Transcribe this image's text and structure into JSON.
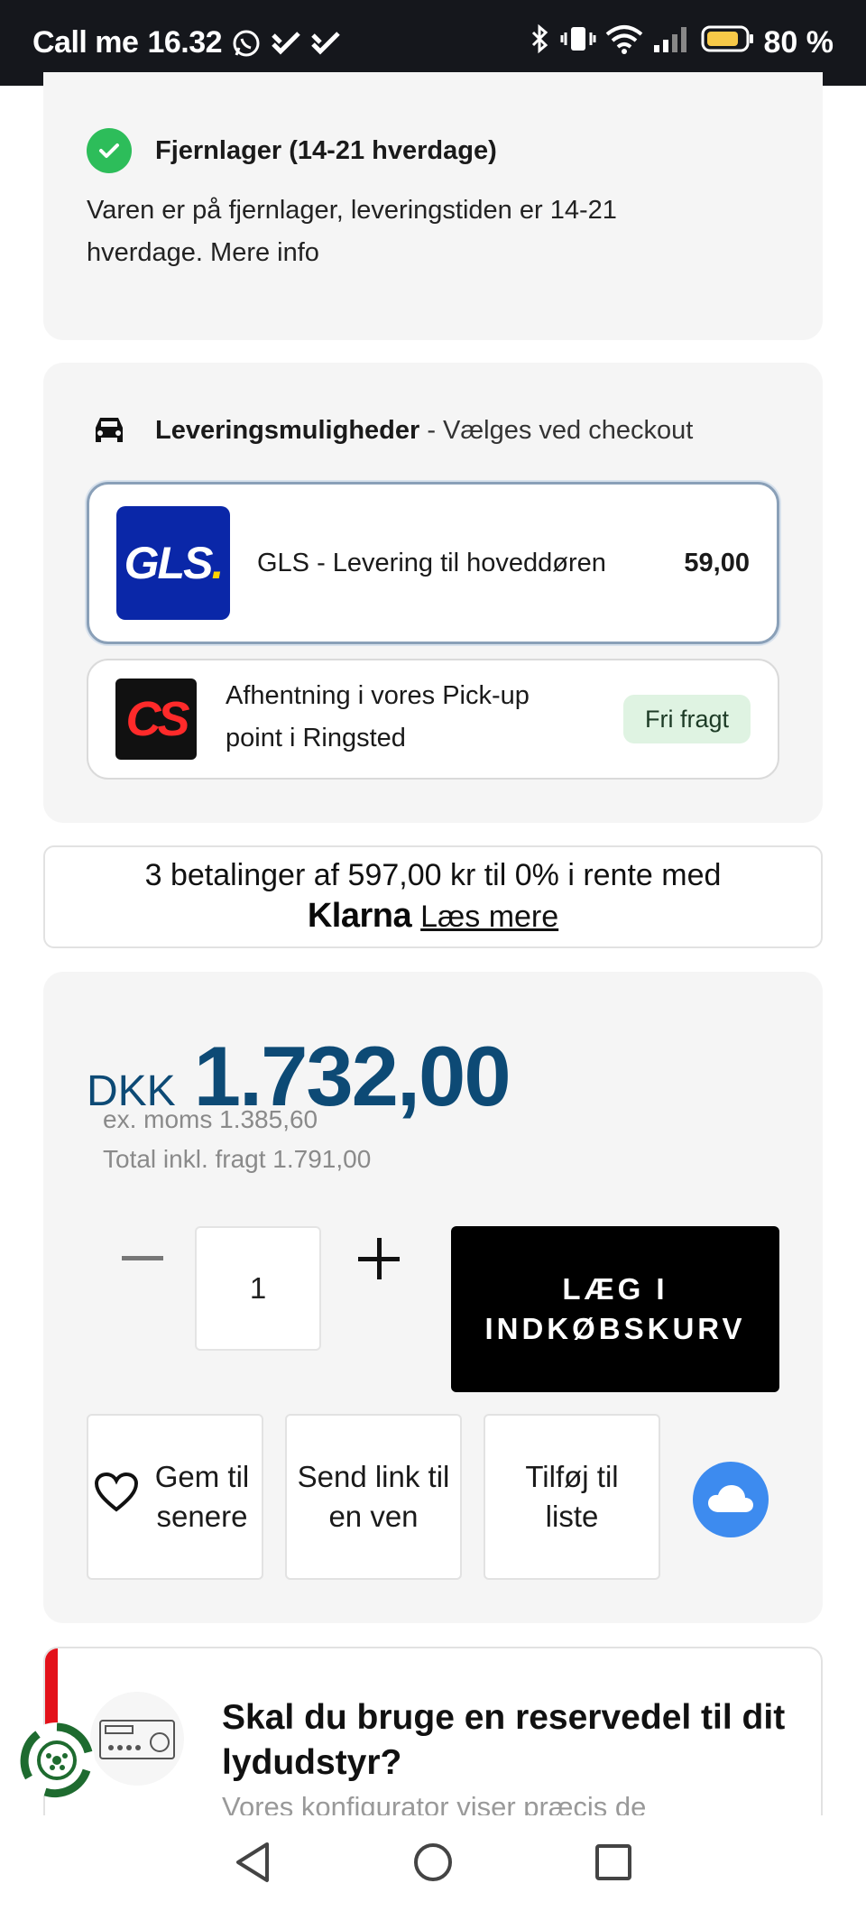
{
  "status_bar": {
    "carrier": "Call me",
    "time": "16.32",
    "battery": "80 %",
    "icons": [
      "whatsapp-icon",
      "check-icon",
      "check-icon",
      "bluetooth-icon",
      "vibrate-icon",
      "wifi-icon",
      "signal-icon",
      "battery-icon"
    ]
  },
  "stock": {
    "title": "Fjernlager (14-21 hverdage)",
    "text": "Varen er på fjernlager, leveringstiden er 14-21 hverdage. Mere info",
    "icon": "check-icon"
  },
  "delivery": {
    "heading_bold": "Leveringsmuligheder",
    "heading_sub": "- Vælges ved checkout",
    "options": [
      {
        "logo_text": "GLS",
        "label": "GLS - Levering til hoveddøren",
        "price": "59,00",
        "selected": true
      },
      {
        "logo_text": "CS",
        "label": "Afhentning i vores Pick-up point i Ringsted",
        "badge": "Fri fragt",
        "selected": false
      }
    ]
  },
  "klarna": {
    "line1": "3 betalinger af 597,00 kr til 0% i rente med",
    "logo": "Klarna",
    "link": "Læs mere"
  },
  "price": {
    "currency": "DKK",
    "value": "1.732,00",
    "ex_moms": "ex. moms 1.385,60",
    "total_fragt": "Total inkl. fragt 1.791,00",
    "color": "#0d4a75"
  },
  "quantity": {
    "value": "1",
    "minus_icon": "minus-icon",
    "plus_icon": "plus-icon"
  },
  "cart_button": {
    "label": "LÆG I INDKØBSKURV"
  },
  "actions": {
    "save": "Gem til senere",
    "send": "Send link til en ven",
    "list": "Tilføj til liste",
    "cloud_icon": "cloud-icon"
  },
  "promo": {
    "title": "Skal du bruge en reservedel til dit lydudstyr?",
    "text": "Vores konfigurator viser præcis de"
  },
  "nav": {
    "icons": [
      "back-icon",
      "home-icon",
      "recents-icon"
    ]
  }
}
